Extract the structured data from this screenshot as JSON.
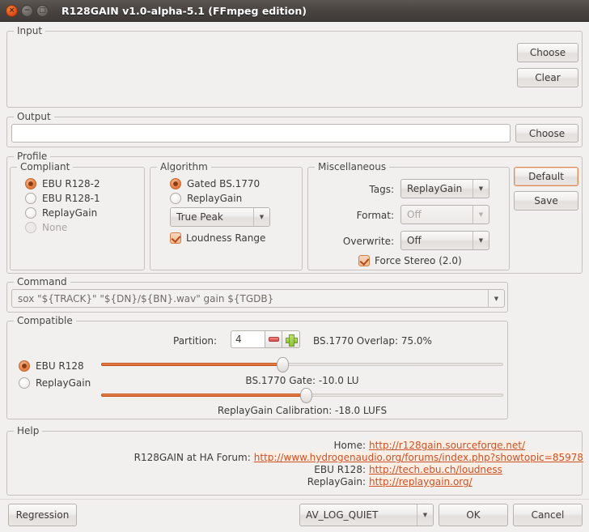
{
  "window": {
    "title": "R128GAIN v1.0-alpha-5.1 (FFmpeg edition)",
    "close_icon": "close-icon",
    "minimize_icon": "minimize-icon",
    "maximize_icon": "maximize-icon",
    "close_glyph": "×",
    "minimize_glyph": "−",
    "maximize_glyph": "□"
  },
  "input": {
    "legend": "Input",
    "list_value": "",
    "choose_label": "Choose",
    "clear_label": "Clear"
  },
  "output": {
    "legend": "Output",
    "path_value": "",
    "path_placeholder": "",
    "choose_label": "Choose"
  },
  "profile": {
    "legend": "Profile",
    "compliant": {
      "legend": "Compliant",
      "options": [
        {
          "label": "EBU R128-2",
          "checked": true,
          "disabled": false
        },
        {
          "label": "EBU R128-1",
          "checked": false,
          "disabled": false
        },
        {
          "label": "ReplayGain",
          "checked": false,
          "disabled": false
        },
        {
          "label": "None",
          "checked": false,
          "disabled": true
        }
      ]
    },
    "algorithm": {
      "legend": "Algorithm",
      "options": [
        {
          "label": "Gated BS.1770",
          "checked": true,
          "disabled": false
        },
        {
          "label": "ReplayGain",
          "checked": false,
          "disabled": false
        }
      ],
      "peak_combo": {
        "value": "True Peak",
        "arrow": "▼",
        "disabled": false
      },
      "loudness_range": {
        "label": "Loudness Range",
        "checked": true
      }
    },
    "miscellaneous": {
      "legend": "Miscellaneous",
      "tags_label": "Tags:",
      "tags_value": "ReplayGain",
      "tags_disabled": false,
      "format_label": "Format:",
      "format_value": "Off",
      "format_disabled": true,
      "overwrite_label": "Overwrite:",
      "overwrite_value": "Off",
      "overwrite_disabled": false,
      "force_stereo": {
        "label": "Force Stereo (2.0)",
        "checked": true
      },
      "arrow": "▼"
    },
    "default_label": "Default",
    "save_label": "Save"
  },
  "command": {
    "legend": "Command",
    "value": "sox \"${TRACK}\" \"${DN}/${BN}.wav\" gain ${TGDB}",
    "arrow": "▼"
  },
  "compatible": {
    "legend": "Compatible",
    "partition_label": "Partition:",
    "partition_value": "4",
    "minus_icon": "minus-icon",
    "plus_icon": "plus-icon",
    "overlap_text": "BS.1770 Overlap: 75.0%",
    "modes": [
      {
        "label": "EBU R128",
        "checked": true
      },
      {
        "label": "ReplayGain",
        "checked": false
      }
    ],
    "gate_text": "BS.1770 Gate: -10.0 LU",
    "calibration_text": "ReplayGain Calibration: -18.0 LUFS",
    "slider_overlap_pct": 45,
    "slider_gate_pct": 51
  },
  "help": {
    "legend": "Help",
    "rows": [
      {
        "label": "Home:",
        "url": "http://r128gain.sourceforge.net/"
      },
      {
        "label": "R128GAIN at HA Forum:",
        "url": "http://www.hydrogenaudio.org/forums/index.php?showtopic=85978"
      },
      {
        "label": "EBU R128:",
        "url": "http://tech.ebu.ch/loudness"
      },
      {
        "label": "ReplayGain:",
        "url": "http://replaygain.org/"
      }
    ]
  },
  "footer": {
    "regression_label": "Regression",
    "loglevel_value": "AV_LOG_QUIET",
    "loglevel_arrow": "▼",
    "ok_label": "OK",
    "cancel_label": "Cancel"
  },
  "colors": {
    "accent": "#e2703a",
    "link": "#c9522a",
    "window_bg": "#f2f0ef",
    "titlebar": "#4a4441"
  }
}
